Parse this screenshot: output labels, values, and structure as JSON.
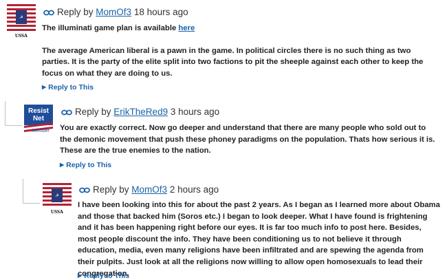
{
  "comments": [
    {
      "avatar_text": "USSA",
      "reply_by": "Reply by",
      "author": "MomOf3",
      "time": "18 hours ago",
      "line1_text": "The illuminati game plan is available ",
      "line1_link": "here",
      "paragraph": "The average American liberal is a pawn in the game. In political circles there is no such thing as two parties. It is the party of the elite split into two factions to pit the sheeple against each other to keep the focus on what they are doing to us.",
      "reply_label": "Reply to This"
    },
    {
      "avatar_line1": "Resist",
      "avatar_line2": "Net",
      "avatar_line3": "Member",
      "reply_by": "Reply by",
      "author": "ErikTheRed9",
      "time": "3 hours ago",
      "paragraph": "You are exactly correct. Now go deeper and understand that there are many people who sold out to the demonic movement that push these phoney paradigms on the population. Thats how serious it is. These are the true enemies to the nation.",
      "reply_label": "Reply to This"
    },
    {
      "avatar_text": "USSA",
      "reply_by": "Reply by",
      "author": "MomOf3",
      "time": "2 hours ago",
      "paragraph": "I have been looking into this for about the past 2 years. As I began as I learned more about Obama and those that backed him (Soros etc.) I began to look deeper. What I have found is frightening and it has been happening right before our eyes. It is far too much info to post here. Besides, most people discount the info. They have been conditioning us to not believe it through education, media, even many religions have been infiltrated and are spewing the agenda from their pulpits. Just look at all the religions now willing to allow open homosexuals to lead their congregation.",
      "reply_label": "Reply to This"
    }
  ],
  "colors": {
    "link": "#1a62a8",
    "flag_red": "#b22234",
    "flag_blue": "#2b3a7a",
    "resist_blue": "#1f4d9a"
  }
}
